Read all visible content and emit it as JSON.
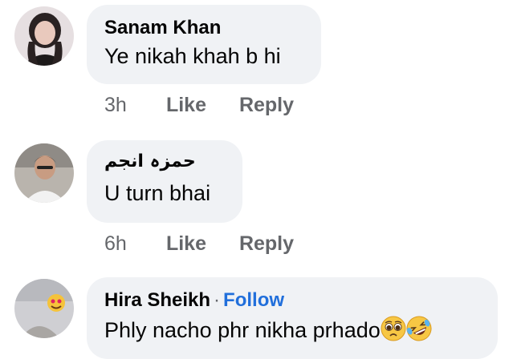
{
  "comments": [
    {
      "author": "Sanam Khan",
      "text": "Ye nikah khah b hi",
      "time": "3h",
      "like_label": "Like",
      "reply_label": "Reply"
    },
    {
      "author": "حمزہ انجم",
      "text": "U turn bhai",
      "time": "6h",
      "like_label": "Like",
      "reply_label": "Reply"
    },
    {
      "author": "Hira Sheikh",
      "separator": "·",
      "follow_label": "Follow",
      "text": "Phly nacho phr nikha prhado",
      "emojis": [
        "pleading-face-emoji",
        "rolling-laughing-emoji"
      ]
    }
  ],
  "colors": {
    "bubble": "#f0f2f5",
    "text": "#050505",
    "secondary": "#65676b",
    "follow": "#216fdb"
  }
}
